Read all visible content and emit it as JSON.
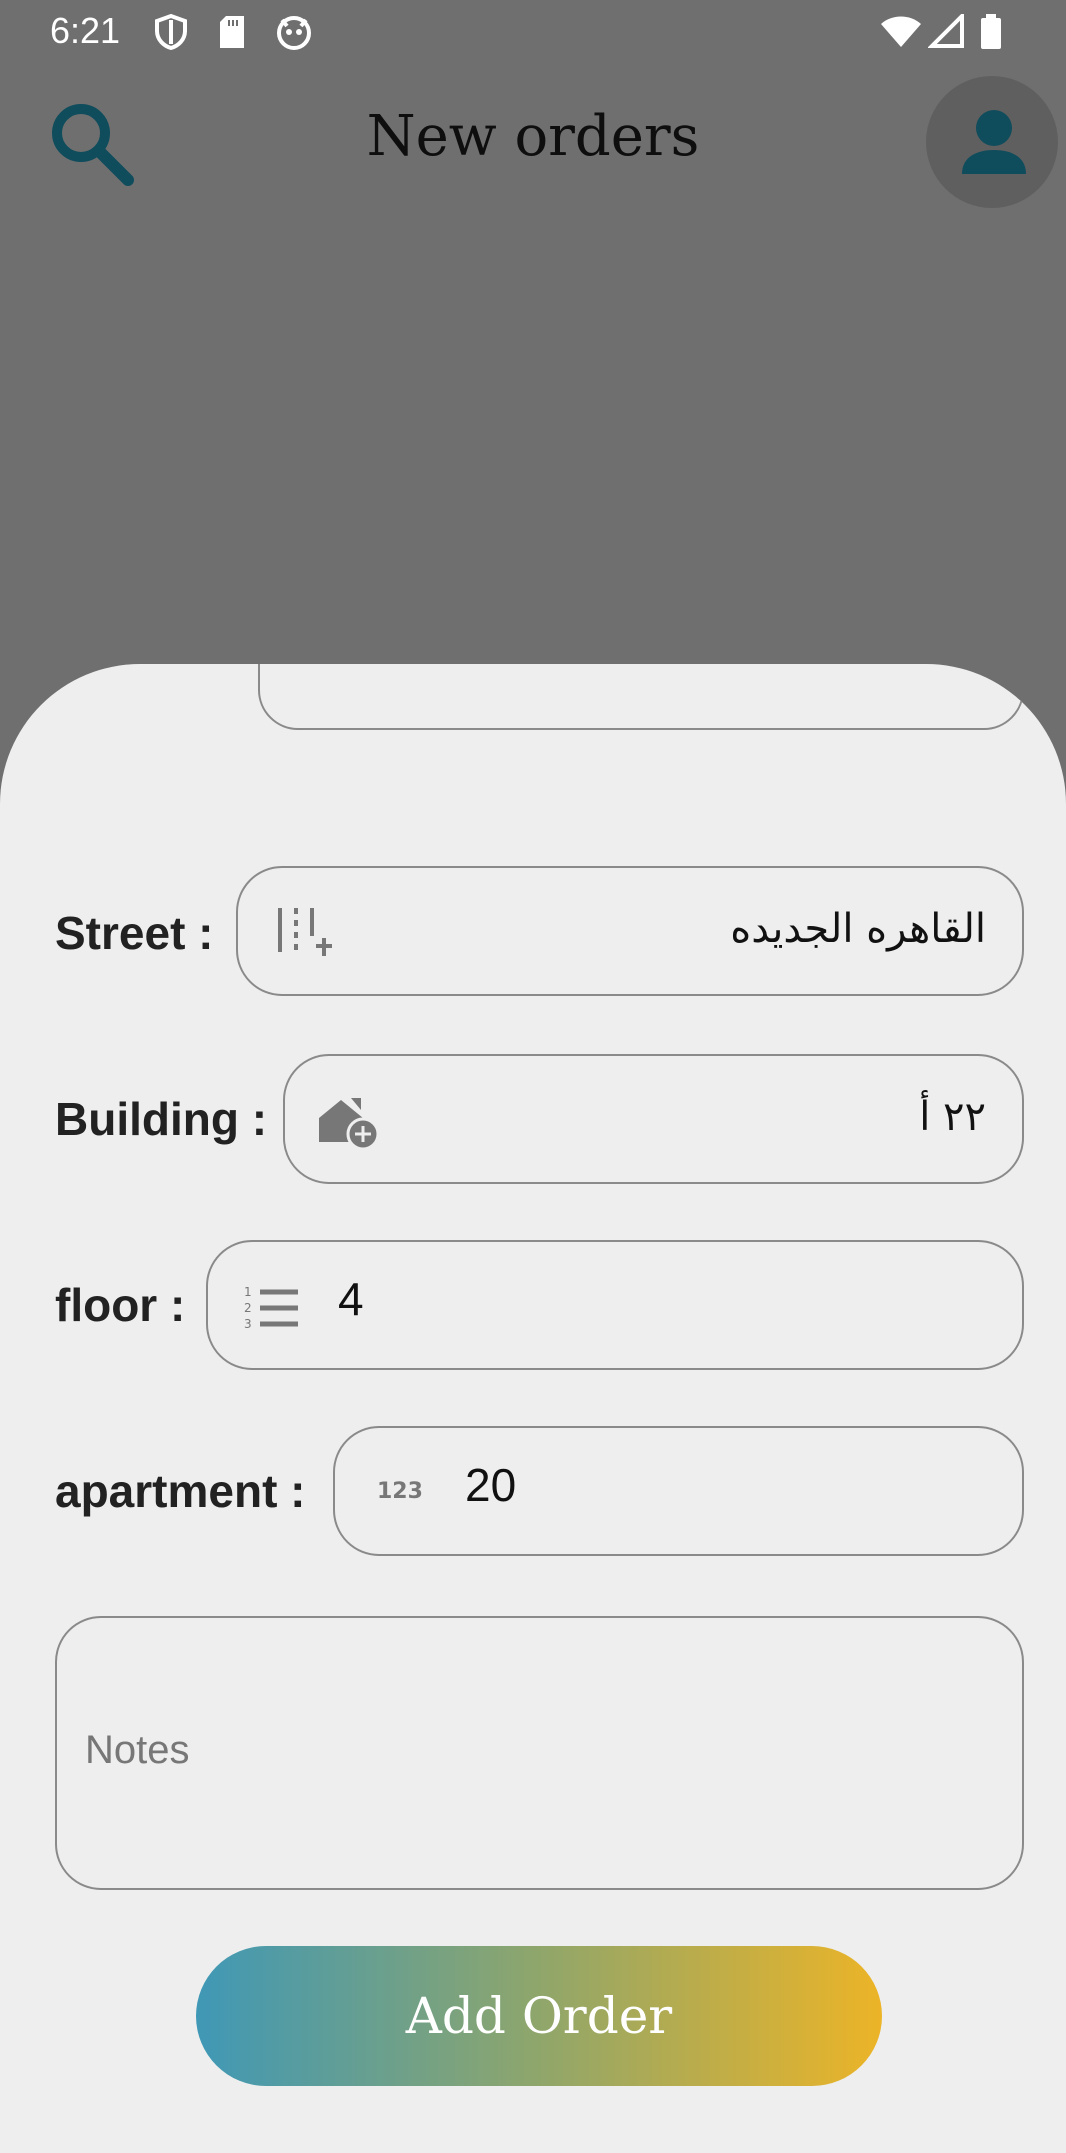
{
  "status_bar": {
    "time": "6:21",
    "left_icons": [
      "shield-icon",
      "sd-card-icon",
      "cat-icon"
    ],
    "right_icons": [
      "wifi-icon",
      "signal-icon",
      "battery-icon"
    ]
  },
  "app_bar": {
    "title": "New orders",
    "search_icon": "search-icon",
    "profile_icon": "person-icon"
  },
  "form": {
    "street": {
      "label": "Street :",
      "value": "القاهره الجديده",
      "icon": "column-add-icon"
    },
    "building": {
      "label": "Building :",
      "value": "٢٢ أ",
      "icon": "house-add-icon"
    },
    "floor": {
      "label": "floor :",
      "value": "4",
      "icon": "numbered-list-icon"
    },
    "apartment": {
      "label": "apartment :",
      "value": "20",
      "icon": "numbers-123-icon"
    },
    "notes": {
      "placeholder": "Notes"
    },
    "submit_label": "Add Order"
  },
  "colors": {
    "background": "#6f6f6f",
    "sheet": "#eeeeee",
    "accent": "#0f4c5c",
    "gradient_start": "#3f98b6",
    "gradient_end": "#ecb427"
  }
}
